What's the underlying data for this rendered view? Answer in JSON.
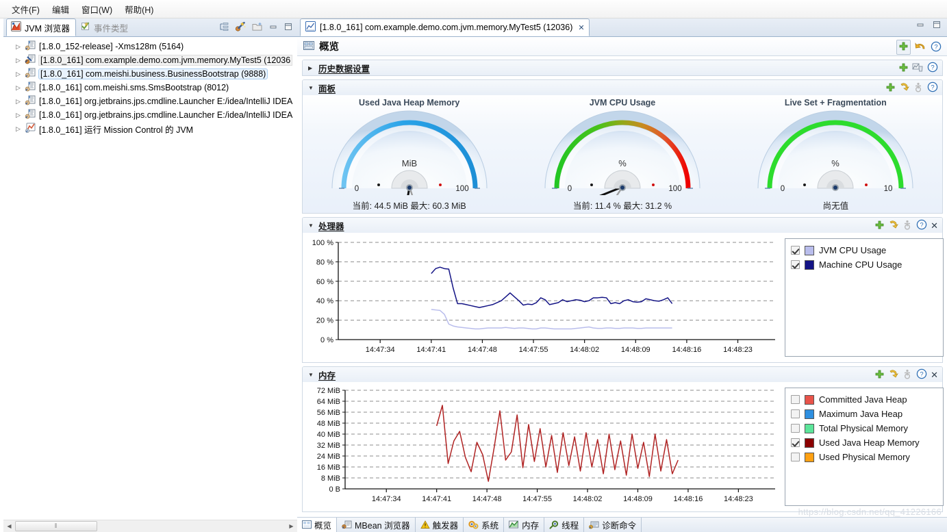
{
  "menubar": {
    "items": [
      {
        "label": "文件(F)",
        "name": "menu-file"
      },
      {
        "label": "编辑",
        "name": "menu-edit"
      },
      {
        "label": "窗口(W)",
        "name": "menu-window"
      },
      {
        "label": "帮助(H)",
        "name": "menu-help"
      }
    ]
  },
  "left_panel": {
    "tabs": [
      {
        "label": "JVM 浏览器",
        "active": true
      },
      {
        "label": "事件类型",
        "active": false
      }
    ],
    "toolbar_icons": [
      "collapse-all-icon",
      "flight-recording-icon",
      "new-folder-icon",
      "minimize-icon",
      "maximize-icon"
    ],
    "tree_items": [
      {
        "label": "[1.8.0_152-release] -Xms128m (5164)",
        "state": "normal"
      },
      {
        "label": "[1.8.0_161] com.example.demo.com.jvm.memory.MyTest5 (12036",
        "state": "connected"
      },
      {
        "label": "[1.8.0_161] com.meishi.business.BusinessBootstrap (9888)",
        "state": "selected"
      },
      {
        "label": "[1.8.0_161] com.meishi.sms.SmsBootstrap (8012)",
        "state": "normal"
      },
      {
        "label": "[1.8.0_161] org.jetbrains.jps.cmdline.Launcher E:/idea/IntelliJ IDEA",
        "state": "normal"
      },
      {
        "label": "[1.8.0_161] org.jetbrains.jps.cmdline.Launcher E:/idea/IntelliJ IDEA",
        "state": "normal"
      },
      {
        "label": "[1.8.0_161] 运行 Mission Control 的 JVM",
        "state": "normal"
      }
    ],
    "hscroll": {
      "thumb_glyph": "⦀"
    }
  },
  "right_panel": {
    "tab": {
      "label": "[1.8.0_161] com.example.demo.com.jvm.memory.MyTest5 (12036)",
      "close_glyph": "✕"
    },
    "window_icons": [
      "minimize-icon",
      "maximize-icon"
    ],
    "page_title": "概览",
    "page_title_icons": [
      "add-icon",
      "undo-icon",
      "help-icon"
    ],
    "sections": [
      {
        "id": "history",
        "title": "历史数据设置",
        "expanded": false,
        "twisty": "▶",
        "icons": [
          "add-icon",
          "reset-icon",
          "help-icon"
        ]
      },
      {
        "id": "dashboard",
        "title": "面板",
        "expanded": true,
        "twisty": "▼",
        "icons": [
          "add-icon",
          "refresh-icon",
          "accessibility-icon",
          "help-icon"
        ]
      },
      {
        "id": "processor",
        "title": "处理器",
        "expanded": true,
        "twisty": "▼",
        "icons": [
          "add-icon",
          "refresh-icon",
          "accessibility-icon",
          "help-icon",
          "close-icon"
        ]
      },
      {
        "id": "memory",
        "title": "内存",
        "expanded": true,
        "twisty": "▼",
        "icons": [
          "add-icon",
          "refresh-icon",
          "accessibility-icon",
          "help-icon",
          "close-icon"
        ]
      }
    ],
    "bottom_tabs": [
      {
        "label": "概览",
        "icon": "overview-icon",
        "active": true
      },
      {
        "label": "MBean 浏览器",
        "icon": "mbean-icon",
        "active": false
      },
      {
        "label": "触发器",
        "icon": "trigger-icon",
        "active": false
      },
      {
        "label": "系统",
        "icon": "system-icon",
        "active": false
      },
      {
        "label": "内存",
        "icon": "memory-icon",
        "active": false
      },
      {
        "label": "线程",
        "icon": "thread-icon",
        "active": false
      },
      {
        "label": "诊断命令",
        "icon": "diagnostic-icon",
        "active": false
      }
    ],
    "watermark": "https://blog.csdn.net/qq_41226166"
  },
  "colors": {
    "gauge_heap_arc": "#29a3e8",
    "gauge_cpu_arc_start": "#22c624",
    "gauge_cpu_arc_end": "#ef0000",
    "gauge_live_arc": "#2ddc2d",
    "machine_cpu_line": "#131385",
    "jvm_cpu_line": "#b9bdec",
    "used_heap_line": "#b02323",
    "committed_heap": "#e8534a",
    "maximum_heap": "#2e8fe0",
    "total_physical": "#5ce59a",
    "used_heap_sw": "#8b0000",
    "used_physical": "#ffa012"
  },
  "gauges": [
    {
      "title": "Used Java Heap Memory",
      "unit": "MiB",
      "value_text": "当前: 44.5 MiB 最大: 60.3 MiB",
      "current": 44.5,
      "max": 60.3,
      "scale_min": 0,
      "scale_max": 100,
      "ticks": [
        0,
        10,
        20,
        30,
        40,
        50,
        60,
        70,
        80,
        90,
        100
      ],
      "arc_style": "solid-blue",
      "has_needles": true
    },
    {
      "title": "JVM CPU Usage",
      "unit": "%",
      "value_text": "当前: 11.4 % 最大: 31.2 %",
      "current": 11.4,
      "max": 31.2,
      "scale_min": 0,
      "scale_max": 100,
      "ticks": [
        0,
        10,
        20,
        30,
        40,
        50,
        60,
        70,
        80,
        90,
        100
      ],
      "arc_style": "green-red-gradient",
      "has_needles": true
    },
    {
      "title": "Live Set + Fragmentation",
      "unit": "%",
      "value_text": "尚无值",
      "current": null,
      "max": null,
      "scale_min": 0,
      "scale_max": 10,
      "ticks": [
        0,
        1,
        2,
        3,
        4,
        5,
        6,
        7,
        8,
        9,
        10
      ],
      "arc_style": "solid-green",
      "has_needles": false
    }
  ],
  "chart_data": [
    {
      "id": "processor-chart",
      "type": "line",
      "title": "处理器",
      "xlabel": "",
      "ylabel": "",
      "ylim": [
        0,
        100
      ],
      "yticks": [
        0,
        20,
        40,
        60,
        80,
        100
      ],
      "ytick_labels": [
        "0 %",
        "20 %",
        "40 %",
        "60 %",
        "80 %",
        "100 %"
      ],
      "xtick_labels": [
        "14:47:34",
        "14:47:41",
        "14:47:48",
        "14:47:55",
        "14:48:02",
        "14:48:09",
        "14:48:16",
        "14:48:23"
      ],
      "grid": true,
      "legend_position": "right",
      "series": [
        {
          "name": "Machine CPU Usage",
          "color": "#131385",
          "checked": true,
          "x": [
            41.0,
            41.6,
            42.2,
            42.8,
            43.4,
            44.0,
            44.6,
            45.2,
            45.8,
            46.4,
            47.0,
            47.6,
            48.2,
            48.8,
            49.4,
            50.0,
            50.6,
            51.2,
            51.8,
            52.4,
            53.0,
            53.6,
            54.2,
            54.8,
            55.4,
            56.0,
            56.6,
            57.2,
            57.8,
            58.4,
            59.0,
            59.6,
            60.2,
            60.8,
            61.4,
            62.0,
            62.6,
            63.2,
            63.8,
            64.4,
            65.0,
            65.6,
            66.2,
            66.8,
            67.4,
            68.0,
            68.6,
            69.2,
            69.8,
            70.4,
            71.0,
            71.6,
            72.2,
            72.8,
            73.4,
            74.0
          ],
          "values": [
            68,
            73,
            74.5,
            73,
            72.5,
            53,
            37,
            37,
            36,
            35,
            34,
            33,
            34,
            35,
            36,
            38,
            40,
            44,
            48,
            44,
            40,
            35.5,
            36.5,
            36,
            38,
            43,
            41,
            36,
            37,
            38,
            41,
            39,
            40,
            41,
            40.5,
            39,
            40,
            43,
            43,
            43.5,
            43,
            37,
            38,
            37,
            40,
            41,
            39,
            38.5,
            39,
            42,
            41,
            40,
            39.5,
            41,
            43,
            37
          ]
        },
        {
          "name": "JVM CPU Usage",
          "color": "#b9bdec",
          "checked": true,
          "x": [
            41.0,
            41.6,
            42.2,
            42.8,
            43.4,
            44.0,
            44.6,
            45.2,
            45.8,
            46.4,
            47.0,
            47.6,
            48.2,
            48.8,
            49.4,
            50.0,
            50.6,
            51.2,
            51.8,
            52.4,
            53.0,
            53.6,
            54.2,
            54.8,
            55.4,
            56.0,
            56.6,
            57.2,
            57.8,
            58.4,
            59.0,
            59.6,
            60.2,
            60.8,
            61.4,
            62.0,
            62.6,
            63.2,
            63.8,
            64.4,
            65.0,
            65.6,
            66.2,
            66.8,
            67.4,
            68.0,
            68.6,
            69.2,
            69.8,
            70.4,
            71.0,
            71.6,
            72.2,
            72.8,
            73.4,
            74.0
          ],
          "values": [
            31,
            30.5,
            30,
            26,
            16,
            14,
            13,
            12.5,
            12,
            11.5,
            11,
            11,
            11.5,
            12,
            12,
            12,
            12,
            12.5,
            12,
            11.5,
            12,
            12,
            11.5,
            11,
            11,
            12,
            12,
            11.5,
            11,
            11,
            11,
            11,
            11,
            11.5,
            12,
            12.5,
            13,
            12,
            11.5,
            11.5,
            12,
            12,
            11.5,
            11.5,
            12,
            12,
            12,
            11.5,
            11.5,
            12,
            12,
            12,
            12,
            12,
            12,
            12
          ]
        }
      ]
    },
    {
      "id": "memory-chart",
      "type": "line",
      "title": "内存",
      "xlabel": "",
      "ylabel": "",
      "ylim": [
        0,
        72
      ],
      "yticks": [
        0,
        8,
        16,
        24,
        32,
        40,
        48,
        56,
        64,
        72
      ],
      "ytick_labels": [
        "0 B",
        "8 MiB",
        "16 MiB",
        "24 MiB",
        "32 MiB",
        "40 MiB",
        "48 MiB",
        "56 MiB",
        "64 MiB",
        "72 MiB"
      ],
      "xtick_labels": [
        "14:47:34",
        "14:47:41",
        "14:47:48",
        "14:47:55",
        "14:48:02",
        "14:48:09",
        "14:48:16",
        "14:48:23"
      ],
      "grid": true,
      "legend_position": "right",
      "series": [
        {
          "name": "Used Java Heap Memory",
          "color": "#b02323",
          "checked": true,
          "x": [
            41.0,
            41.8,
            42.6,
            43.4,
            44.2,
            45.0,
            45.8,
            46.6,
            47.4,
            48.2,
            49.0,
            49.8,
            50.6,
            51.4,
            52.2,
            53.0,
            53.8,
            54.6,
            55.4,
            56.2,
            57.0,
            57.8,
            58.6,
            59.4,
            60.2,
            61.0,
            61.8,
            62.6,
            63.4,
            64.2,
            65.0,
            65.8,
            66.6,
            67.4,
            68.2,
            69.0,
            69.8,
            70.6,
            71.4,
            72.2,
            73.0,
            73.8,
            74.6
          ],
          "values": [
            46,
            61,
            18.5,
            35,
            42,
            23,
            12.5,
            34,
            25,
            5.5,
            30,
            57,
            21,
            27,
            54,
            15.5,
            47,
            20,
            44,
            16,
            39,
            12,
            41,
            17,
            38,
            13,
            41,
            16,
            36,
            11,
            40,
            14,
            35,
            10,
            40,
            15,
            34,
            9,
            40,
            13,
            36,
            11,
            21
          ]
        }
      ],
      "legend_items": [
        {
          "name": "Committed Java Heap",
          "color": "#e8534a",
          "checked": false
        },
        {
          "name": "Maximum Java Heap",
          "color": "#2e8fe0",
          "checked": false
        },
        {
          "name": "Total Physical Memory",
          "color": "#5ce59a",
          "checked": false
        },
        {
          "name": "Used Java Heap Memory",
          "color": "#8b0000",
          "checked": true
        },
        {
          "name": "Used Physical Memory",
          "color": "#ffa012",
          "checked": false
        }
      ]
    }
  ],
  "processor_legend": [
    {
      "name": "JVM CPU Usage",
      "color": "#b9bdec",
      "checked": true
    },
    {
      "name": "Machine CPU Usage",
      "color": "#131385",
      "checked": true
    }
  ]
}
